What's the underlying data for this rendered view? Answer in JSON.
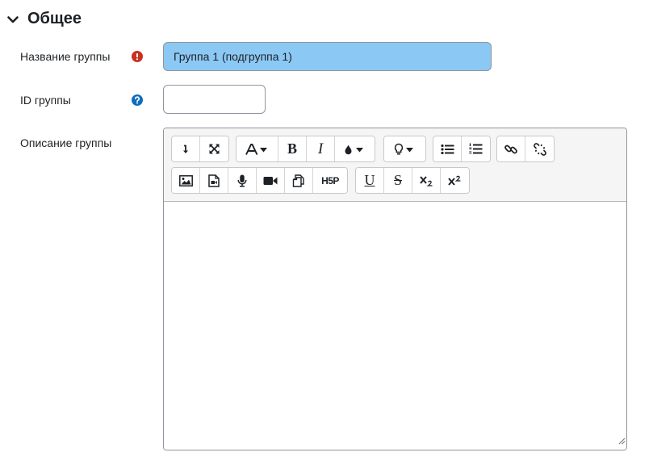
{
  "section": {
    "title": "Общее",
    "icon": "chevron-down-icon"
  },
  "fields": {
    "name": {
      "label": "Название группы",
      "value": "Группа 1 (подгруппа 1)",
      "status_icon": "required-icon",
      "status_color": "#ca3120"
    },
    "idnumber": {
      "label": "ID группы",
      "value": "",
      "status_icon": "help-icon",
      "status_color": "#0f6cbf"
    },
    "description": {
      "label": "Описание группы"
    }
  },
  "editor": {
    "toolbar": {
      "row1": [
        [
          "show-more-icon",
          "fullscreen-icon"
        ],
        [
          "font-style-icon",
          "bold-icon",
          "italic-icon",
          "text-color-icon"
        ],
        [
          "bulb-icon"
        ],
        [
          "unordered-list-icon",
          "ordered-list-icon"
        ],
        [
          "link-icon",
          "unlink-icon"
        ]
      ],
      "row2": [
        [
          "image-icon",
          "media-icon",
          "record-audio-icon",
          "record-video-icon",
          "manage-files-icon",
          "h5p-icon"
        ],
        [
          "underline-icon",
          "strikethrough-icon",
          "subscript-icon",
          "superscript-icon"
        ]
      ],
      "labels": {
        "bold": "B",
        "italic": "I",
        "underline": "U",
        "strike": "S",
        "h5p": "H5P"
      }
    },
    "content": ""
  },
  "colors": {
    "input_highlight": "#8cc8f4",
    "required": "#ca3120",
    "help": "#0f6cbf"
  }
}
